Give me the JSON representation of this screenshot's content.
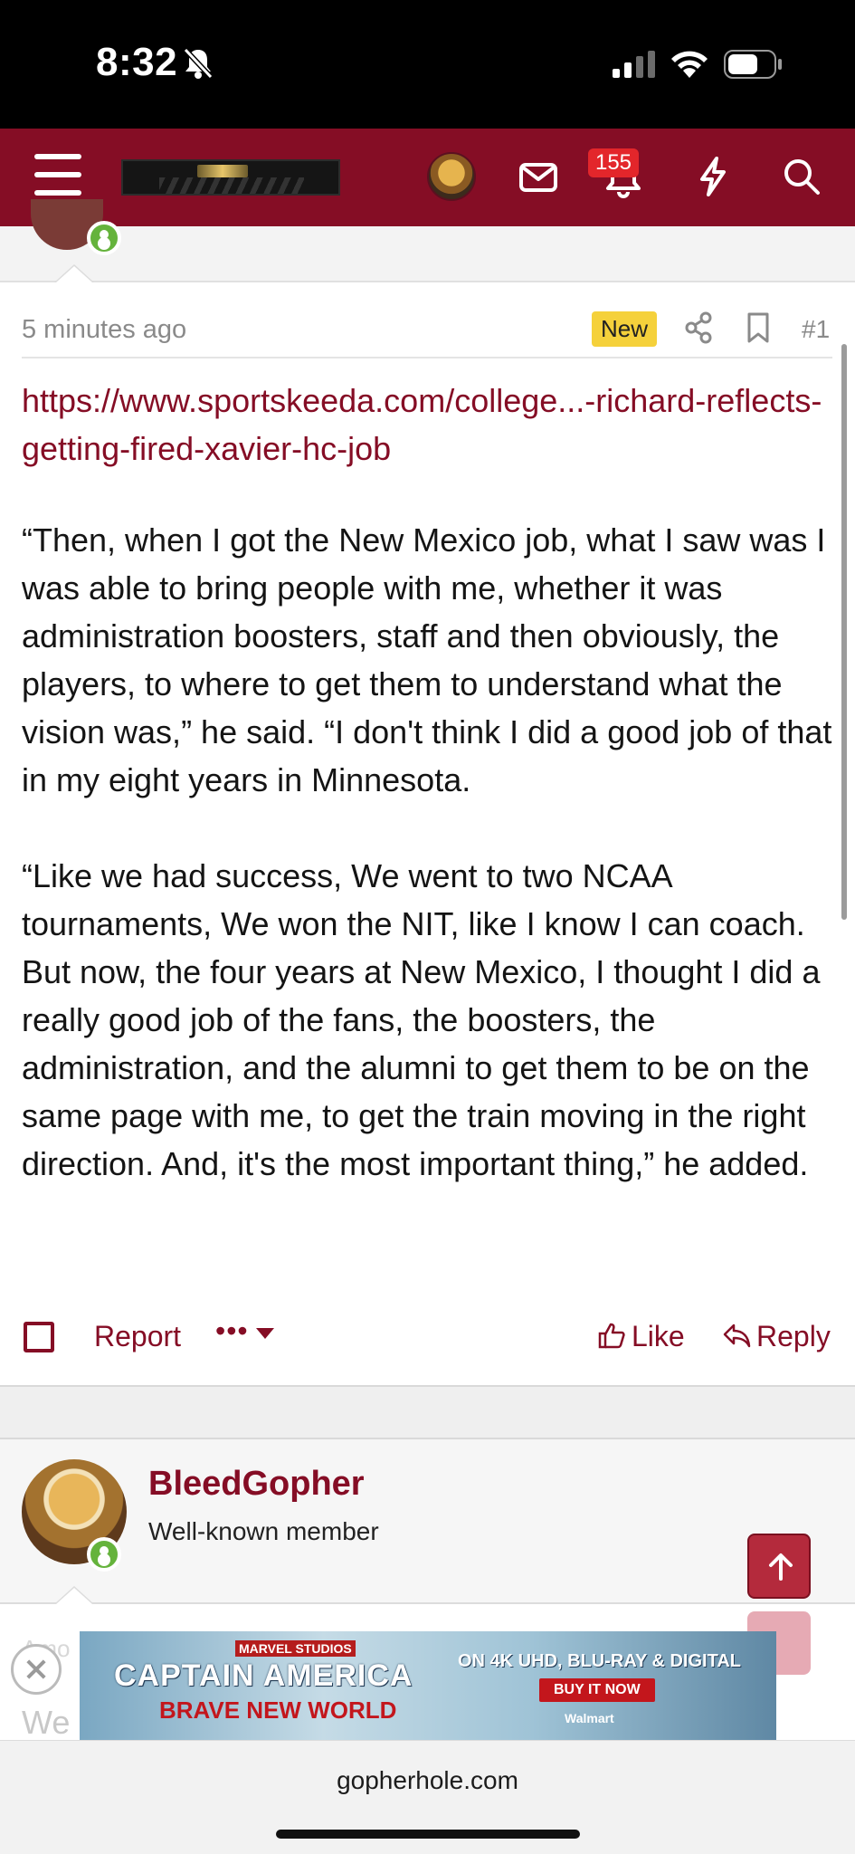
{
  "status_bar": {
    "time": "8:32"
  },
  "nav": {
    "notification_count": "155"
  },
  "post": {
    "time": "5 minutes ago",
    "new_badge": "New",
    "post_number": "#1",
    "link_text": "https://www.sportskeeda.com/college...-richard-reflects-getting-fired-xavier-hc-job",
    "paragraphs": [
      "“Then, when I got the New Mexico job, what I saw was I was able to bring people with me, whether it was administration boosters, staff and then obviously, the players, to where to get them to understand what the vision was,” he said. “I don't think I did a good job of that in my eight years in Minnesota.",
      "“Like we had success, We went to two NCAA tournaments, We won the NIT, like I know I can coach. But now, the four years at New Mexico, I thought I did a really good job of the fans, the boosters, the administration, and the alumni to get them to be on the same page with me, to get the train moving in the right direction. And, it's the most important thing,” he added."
    ],
    "actions": {
      "report": "Report",
      "more": "•••",
      "like": "Like",
      "reply": "Reply"
    }
  },
  "next_post": {
    "username": "BleedGopher",
    "user_title": "Well-known member",
    "peek_top": "Amo",
    "peek_text": "We"
  },
  "ad": {
    "studio": "MARVEL STUDIOS",
    "title": "CAPTAIN AMERICA",
    "subtitle": "BRAVE NEW WORLD",
    "format": "ON 4K UHD, BLU-RAY & DIGITAL",
    "cta": "BUY IT NOW",
    "retailer": "Walmart"
  },
  "browser": {
    "url": "gopherhole.com"
  },
  "colors": {
    "brand": "#850d25",
    "badge": "#e3262b",
    "new_badge": "#f5d13b",
    "online": "#65b33c"
  }
}
